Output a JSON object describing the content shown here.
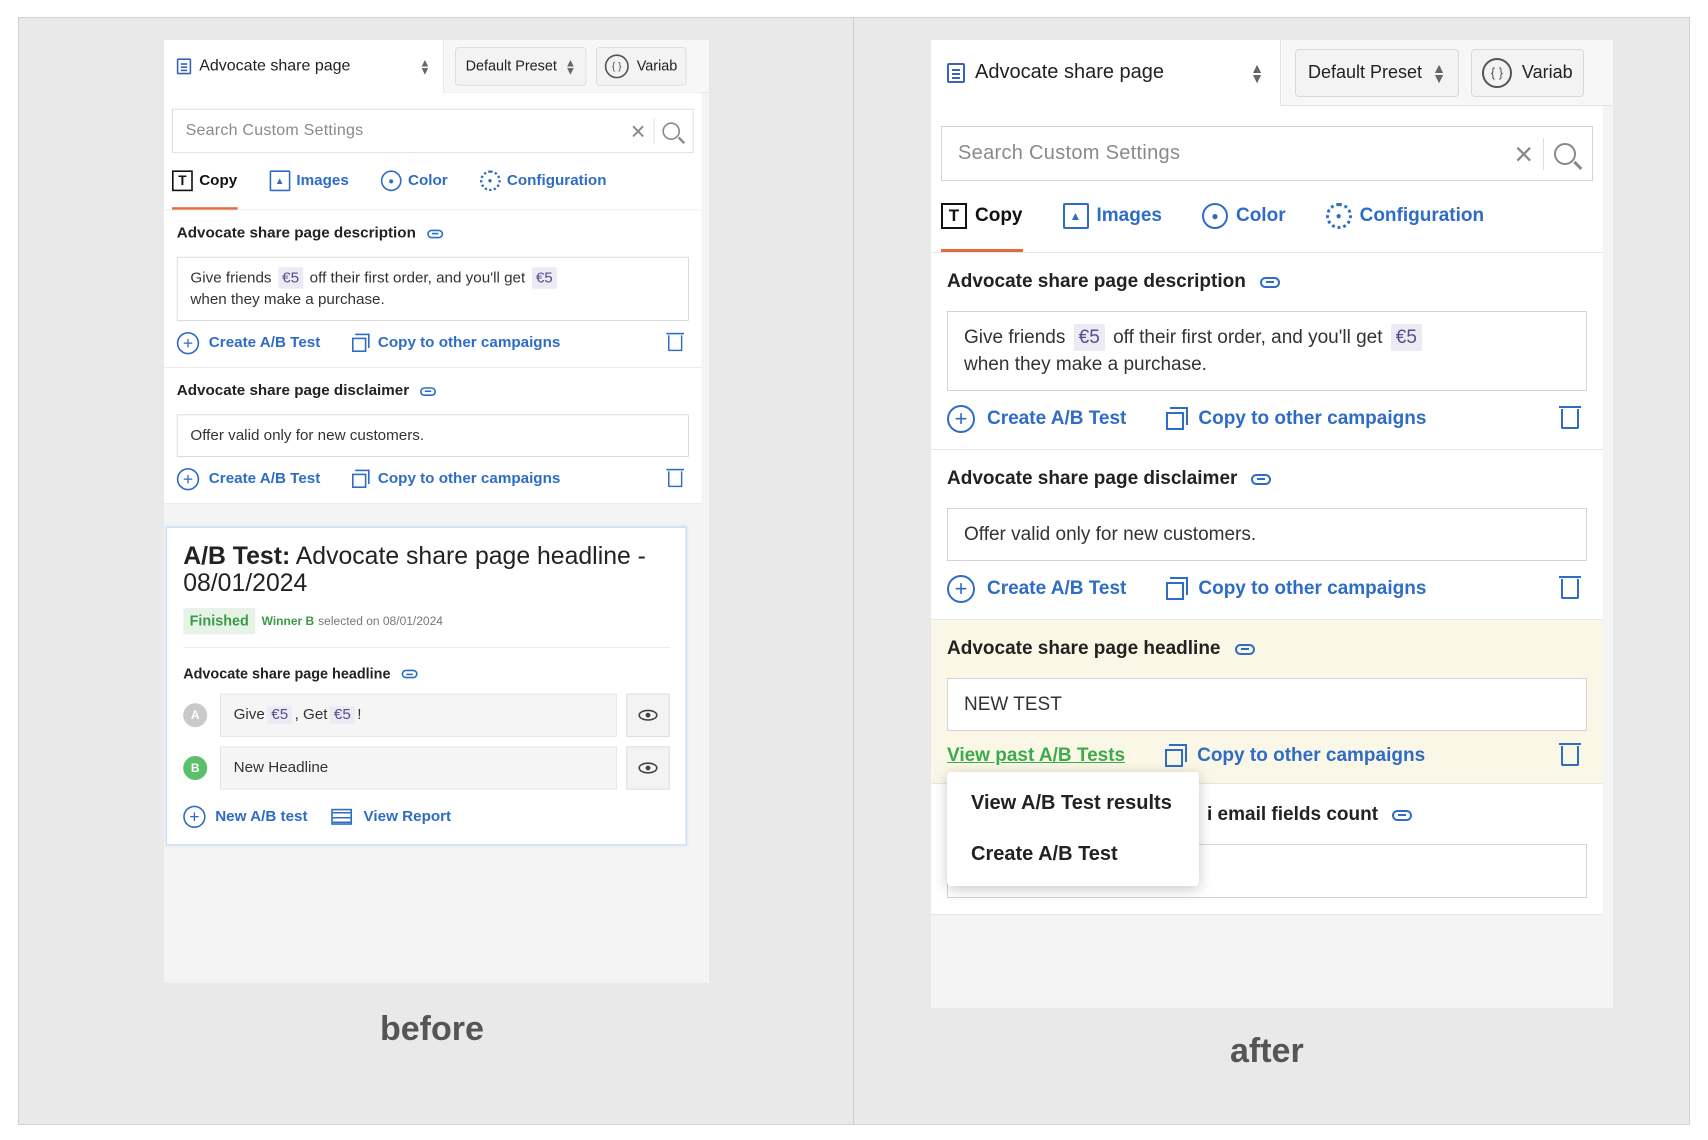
{
  "captions": {
    "before": "before",
    "after": "after"
  },
  "topbar": {
    "page_select": "Advocate share page",
    "preset": "Default Preset",
    "variables": "Variab"
  },
  "search": {
    "placeholder": "Search Custom Settings"
  },
  "tabs": [
    {
      "label": "Copy"
    },
    {
      "label": "Images"
    },
    {
      "label": "Color"
    },
    {
      "label": "Configuration"
    }
  ],
  "sections": {
    "description": {
      "title": "Advocate share page description",
      "text_a": "Give friends",
      "chip": "€5",
      "text_b": "off their first order, and you'll get",
      "text_c": "when they make a purchase."
    },
    "disclaimer": {
      "title": "Advocate share page disclaimer",
      "text": "Offer valid only for new customers."
    },
    "headline": {
      "title": "Advocate share page headline",
      "text": "NEW TEST"
    },
    "email_count": {
      "title_visible": "i email fields count"
    }
  },
  "actions": {
    "create_ab": "Create A/B Test",
    "copy_campaigns": "Copy to other campaigns",
    "view_past": "View past A/B Tests"
  },
  "ab_card": {
    "prefix": "A/B Test:",
    "title": "Advocate share page headline - 08/01/2024",
    "status": "Finished",
    "winner": "Winner B",
    "selected_on": "selected on 08/01/2024",
    "sub_title": "Advocate share page headline",
    "variant_a": {
      "letter": "A",
      "give": "Give",
      "chip": "€5",
      "comma": ", Get",
      "bang": "!"
    },
    "variant_b": {
      "letter": "B",
      "text": "New Headline"
    },
    "new_test": "New A/B test",
    "view_report": "View Report"
  },
  "menu": {
    "items": [
      "View A/B Test results",
      "Create A/B Test"
    ]
  },
  "colors": {
    "link_blue": "#2f6cc6",
    "active_tab_underline": "#e46b3a",
    "success_green": "#3a9a47",
    "highlight_bg": "#fbf7e6"
  }
}
